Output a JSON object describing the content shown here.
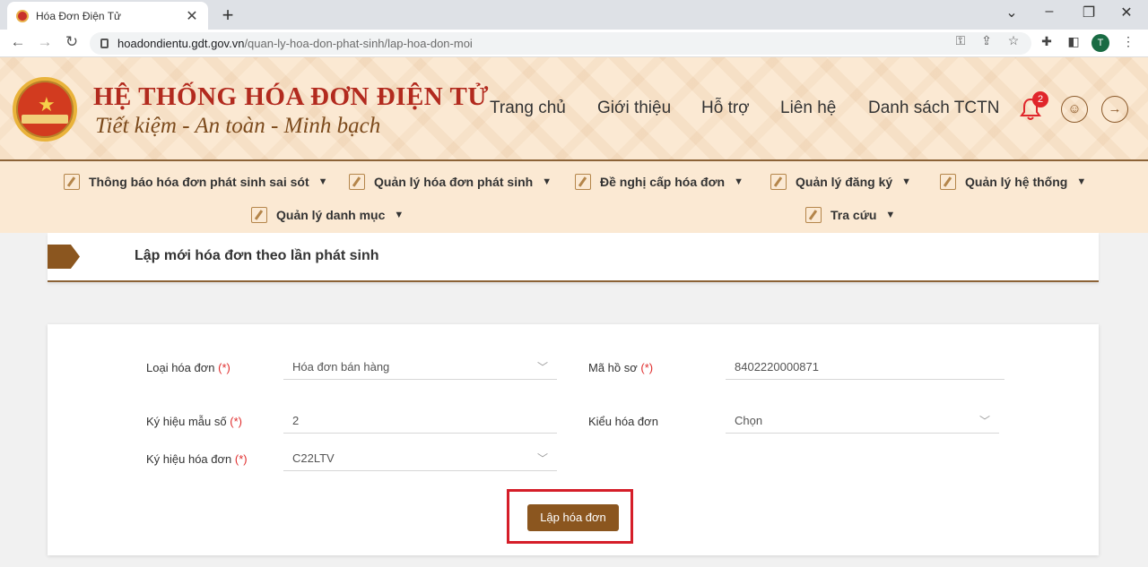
{
  "browser": {
    "tab_title": "Hóa Đơn Điện Tử",
    "new_tab": "+",
    "close": "✕",
    "url_host": "hoadondientu.gdt.gov.vn",
    "url_path": "/quan-ly-hoa-don-phat-sinh/lap-hoa-don-moi",
    "profile_initial": "T"
  },
  "site": {
    "title": "HỆ THỐNG HÓA ĐƠN ĐIỆN TỬ",
    "slogan": "Tiết kiệm - An toàn - Minh bạch",
    "nav": [
      "Trang chủ",
      "Giới thiệu",
      "Hỗ trợ",
      "Liên hệ",
      "Danh sách TCTN"
    ],
    "notification_count": "2"
  },
  "menu": {
    "row1": [
      "Thông báo hóa đơn phát sinh sai sót",
      "Quản lý hóa đơn phát sinh",
      "Đề nghị cấp hóa đơn",
      "Quản lý đăng ký",
      "Quản lý hệ thống"
    ],
    "row2": [
      "Quản lý danh mục",
      "Tra cứu"
    ]
  },
  "page": {
    "title": "Lập mới hóa đơn theo lần phát sinh"
  },
  "form": {
    "loai_hoa_don": {
      "label": "Loại hóa đơn",
      "required": "(*)",
      "value": "Hóa đơn bán hàng"
    },
    "ma_ho_so": {
      "label": "Mã hồ sơ",
      "required": "(*)",
      "value": "8402220000871"
    },
    "ky_hieu_mau_so": {
      "label": "Ký hiệu mẫu số",
      "required": "(*)",
      "value": "2"
    },
    "kieu_hoa_don": {
      "label": "Kiểu hóa đơn",
      "value": "Chọn"
    },
    "ky_hieu_hoa_don": {
      "label": "Ký hiệu hóa đơn",
      "required": "(*)",
      "value": "C22LTV"
    },
    "submit_label": "Lập hóa đơn"
  },
  "colors": {
    "brand_brown": "#8b561f",
    "title_red": "#b22a1e",
    "highlight_red": "#d51e29",
    "header_bg": "#fbe9d3"
  }
}
